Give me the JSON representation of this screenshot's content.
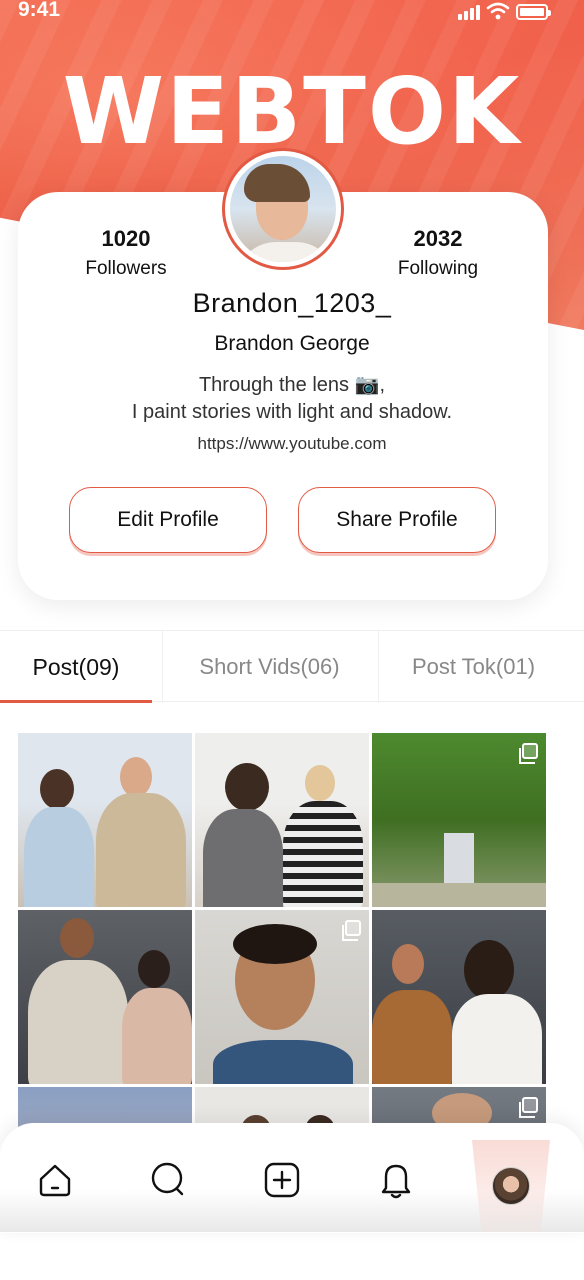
{
  "status_bar": {
    "time": "9:41"
  },
  "brand": {
    "title": "WEBTOK"
  },
  "profile": {
    "followers_count": "1020",
    "followers_label": "Followers",
    "following_count": "2032",
    "following_label": "Following",
    "username": "Brandon_1203_",
    "full_name": "Brandon George",
    "bio_line1": "Through the lens 📷,",
    "bio_line2": "I paint stories with light and shadow.",
    "link": "https://www.youtube.com"
  },
  "buttons": {
    "edit_label": "Edit Profile",
    "share_label": "Share Profile"
  },
  "tabs": [
    {
      "label": "Post(09)",
      "active": true
    },
    {
      "label": "Short Vids(06)",
      "active": false
    },
    {
      "label": "Post Tok(01)",
      "active": false
    }
  ],
  "grid": {
    "visible_posts": 9
  },
  "nav": {
    "items": [
      "home-icon",
      "search-icon",
      "add-icon",
      "bell-icon",
      "profile-avatar"
    ]
  },
  "colors": {
    "accent": "#e25a44",
    "hero": "#ea5740"
  }
}
